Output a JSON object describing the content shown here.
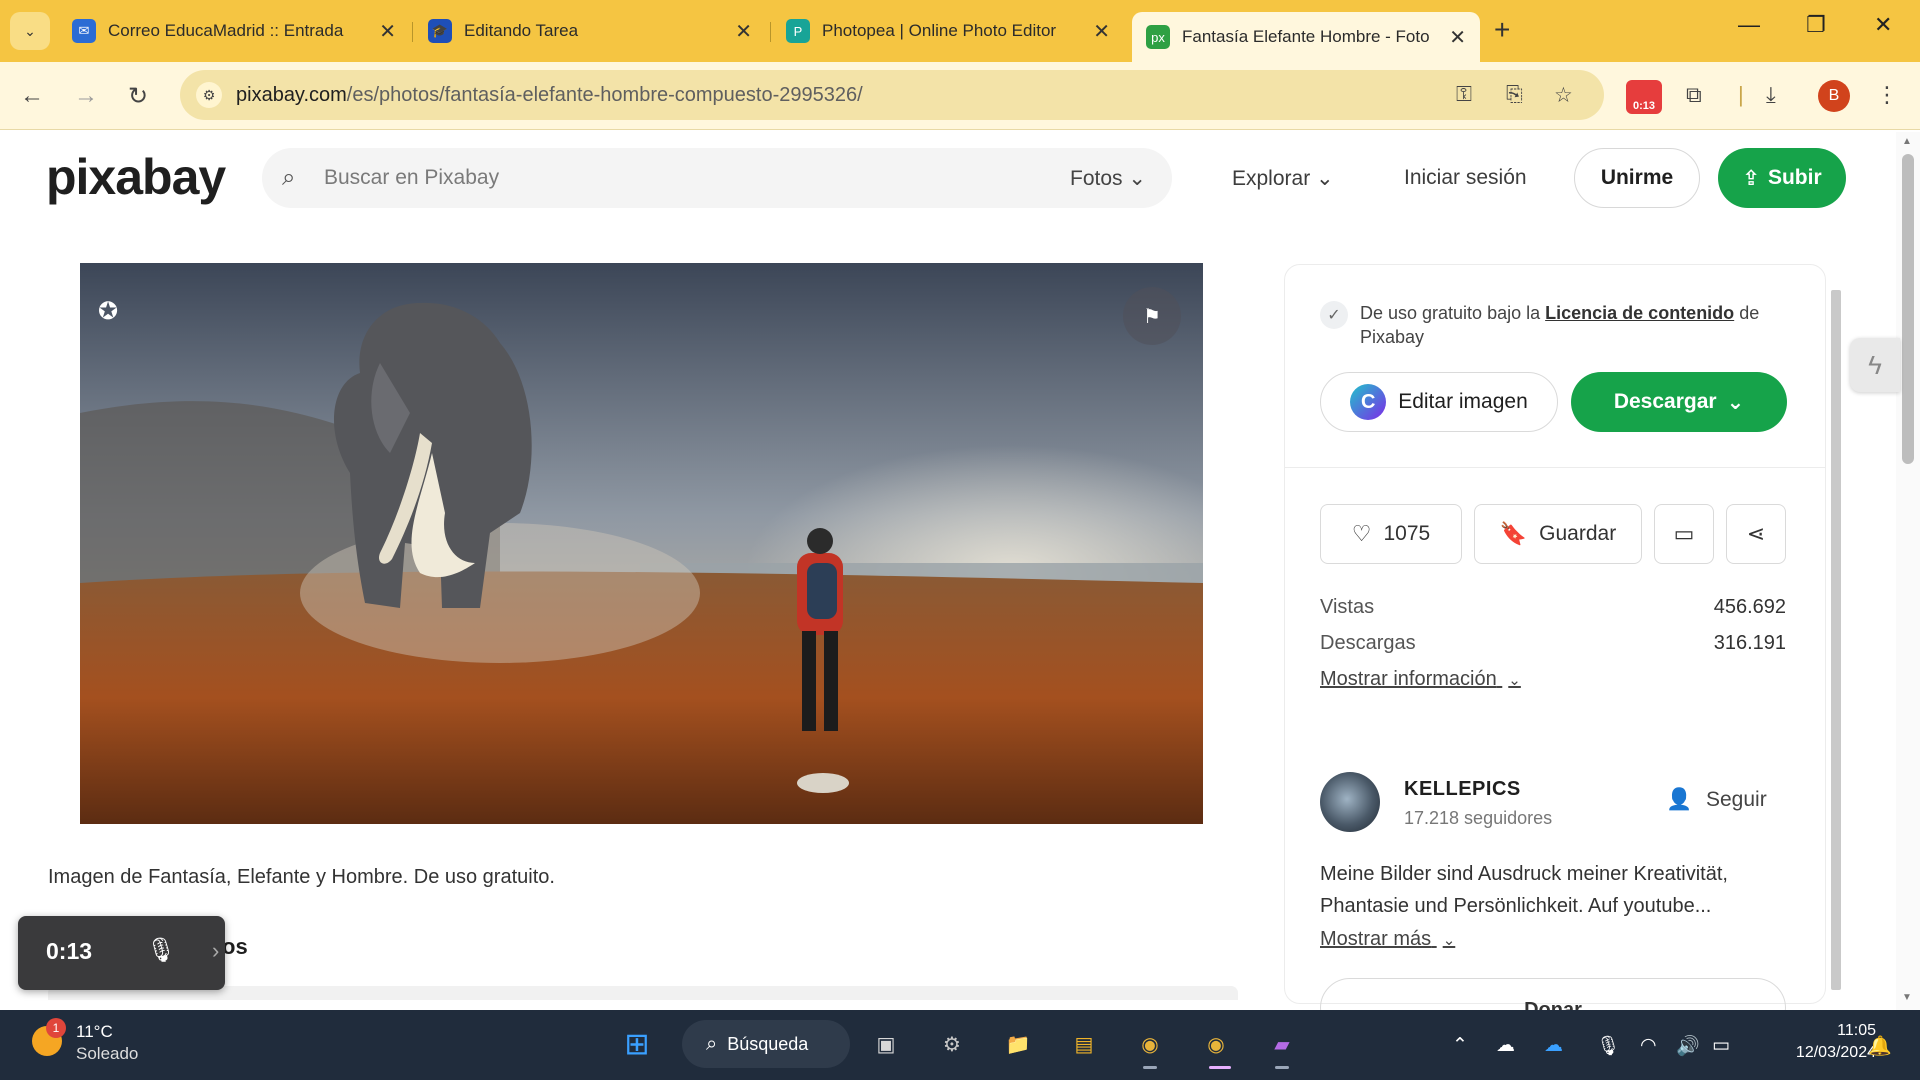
{
  "browser": {
    "tabs": [
      {
        "label": "Correo EducaMadrid :: Entrada",
        "icon": "mail-icon",
        "color": "#2b6cd4"
      },
      {
        "label": "Editando Tarea",
        "icon": "graduation-cap-icon",
        "color": "#1e4fb8"
      },
      {
        "label": "Photopea | Online Photo Editor",
        "icon": "photopea-icon",
        "color": "#18a497"
      },
      {
        "label": "Fantasía Elefante Hombre - Foto",
        "icon": "pixabay-tab-icon",
        "color": "#2ea043"
      }
    ],
    "url_host": "pixabay.com",
    "url_path": "/es/photos/fantasía-elefante-hombre-compuesto-2995326/",
    "recorder_ext_label": "0:13",
    "profile_initial": "B"
  },
  "header": {
    "logo": "pixabay",
    "search_placeholder": "Buscar en Pixabay",
    "search_filter": "Fotos",
    "explore": "Explorar",
    "login": "Iniciar sesión",
    "join": "Unirme",
    "upload": "Subir"
  },
  "photo": {
    "caption": "Imagen de Fantasía, Elefante y Hombre. De uso gratuito.",
    "related_title_partial": "os"
  },
  "recorder": {
    "time": "0:13"
  },
  "panel": {
    "license_prefix": "De uso gratuito bajo la",
    "license_link": "Licencia de contenido",
    "license_suffix": "de Pixabay",
    "edit_button": "Editar imagen",
    "download_button": "Descargar",
    "likes": "1075",
    "save": "Guardar",
    "stats": [
      {
        "label": "Vistas",
        "value": "456.692"
      },
      {
        "label": "Descargas",
        "value": "316.191"
      }
    ],
    "more_info": "Mostrar información",
    "author": {
      "name": "KELLEPICS",
      "followers": "17.218 seguidores",
      "follow": "Seguir",
      "bio": "Meine Bilder sind Ausdruck meiner Kreativität, Phantasie und Persönlichkeit. Auf youtube...",
      "more": "Mostrar más",
      "donate": "Donar"
    }
  },
  "taskbar": {
    "temperature": "11°C",
    "weather": "Soleado",
    "weather_badge": "1",
    "search": "Búsqueda",
    "time": "11:05",
    "date": "12/03/2024"
  },
  "colors": {
    "tabstrip": "#f5c542",
    "brand_green": "#16a34a",
    "taskbar": "#202c3c"
  }
}
